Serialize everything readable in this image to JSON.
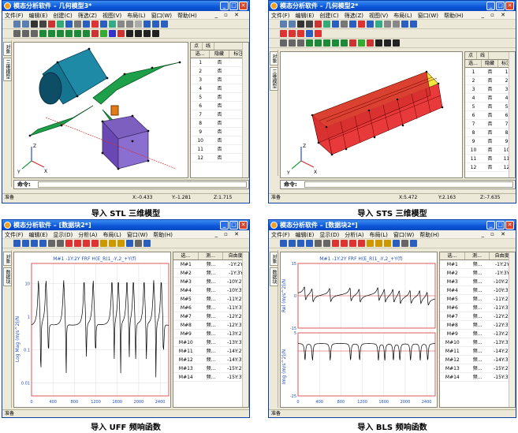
{
  "panels": [
    {
      "window_title": "模态分析软件 – 几何模型3*",
      "menus": [
        "文件(F)",
        "编辑(E)",
        "创建(C)",
        "筛选(Z)",
        "视图(V)",
        "布局(L)",
        "窗口(W)",
        "帮助(H)"
      ],
      "side_tabs": [
        "对象",
        "三维模型"
      ],
      "table_tabs": [
        "点",
        "线"
      ],
      "table_headers": [
        "选...",
        "隐藏",
        "标注"
      ],
      "table_rows": [
        [
          "1",
          "否",
          ""
        ],
        [
          "2",
          "否",
          ""
        ],
        [
          "3",
          "否",
          ""
        ],
        [
          "4",
          "否",
          ""
        ],
        [
          "5",
          "否",
          ""
        ],
        [
          "6",
          "否",
          ""
        ],
        [
          "7",
          "否",
          ""
        ],
        [
          "8",
          "否",
          ""
        ],
        [
          "9",
          "否",
          ""
        ],
        [
          "10",
          "否",
          ""
        ],
        [
          "11",
          "否",
          ""
        ],
        [
          "12",
          "否",
          ""
        ]
      ],
      "command_label": "命令:",
      "status_ready": "准备",
      "status_x": "X:-0.433",
      "status_y": "Y:-1.281",
      "status_z": "Z:1.715",
      "caption": "导入 STL 三维模型",
      "axis_labels": [
        "X",
        "Y",
        "Z"
      ]
    },
    {
      "window_title": "模态分析软件 – 几何模型2*",
      "menus": [
        "文件(F)",
        "编辑(E)",
        "创建(C)",
        "筛选(Z)",
        "视图(V)",
        "布局(L)",
        "窗口(W)",
        "帮助(H)"
      ],
      "side_tabs": [
        "对象",
        "三维模型"
      ],
      "table_tabs": [
        "点",
        "线"
      ],
      "table_headers": [
        "选...",
        "隐藏",
        "标注"
      ],
      "table_rows": [
        [
          "1",
          "否",
          "1"
        ],
        [
          "2",
          "否",
          "2"
        ],
        [
          "3",
          "否",
          "3"
        ],
        [
          "4",
          "否",
          "4"
        ],
        [
          "5",
          "否",
          "5"
        ],
        [
          "6",
          "否",
          "6"
        ],
        [
          "7",
          "否",
          "7"
        ],
        [
          "8",
          "否",
          "8"
        ],
        [
          "9",
          "否",
          "9"
        ],
        [
          "10",
          "否",
          "10"
        ],
        [
          "11",
          "否",
          "11"
        ],
        [
          "12",
          "否",
          "12"
        ]
      ],
      "command_label": "命令:",
      "status_ready": "准备",
      "status_x": "X:5.472",
      "status_y": "Y:2.163",
      "status_z": "Z:-7.635",
      "caption": "导入 STS 三维模型",
      "axis_labels": [
        "X",
        "Y",
        "Z"
      ]
    },
    {
      "window_title": "模态分析软件 – [数据块2*]",
      "menus": [
        "文件(F)",
        "编辑(E)",
        "显示(D)",
        "分析(A)",
        "布局(L)",
        "窗口(W)",
        "帮助(H)"
      ],
      "side_tabs": [
        "对象",
        "数据块"
      ],
      "table_headers": [
        "选...",
        "测...",
        "自由度"
      ],
      "table_rows": [
        [
          "M#1",
          "频...",
          "-1Y:2Y"
        ],
        [
          "M#2",
          "频...",
          "-1Y:3Y"
        ],
        [
          "M#3",
          "频...",
          "-10Y:2Y"
        ],
        [
          "M#4",
          "频...",
          "-10Y:3Y"
        ],
        [
          "M#5",
          "频...",
          "-11Y:2Y"
        ],
        [
          "M#6",
          "频...",
          "-11Y:3Y"
        ],
        [
          "M#7",
          "频...",
          "-12Y:2Y"
        ],
        [
          "M#8",
          "频...",
          "-12Y:3Y"
        ],
        [
          "M#9",
          "频...",
          "-13Y:2Y"
        ],
        [
          "M#10",
          "频...",
          "-13Y:3Y"
        ],
        [
          "M#11",
          "频...",
          "-14Y:2Y"
        ],
        [
          "M#12",
          "频...",
          "-14Y:3Y"
        ],
        [
          "M#13",
          "频...",
          "-15Y:2Y"
        ],
        [
          "M#14",
          "频...",
          "-15Y:3Y"
        ]
      ],
      "status_ready": "准备",
      "caption": "导入 UFF 频响函数",
      "plot_title": "M#1 -1Y:2Y FRF H(E_R)1_-Y,2_+Y(f)"
    },
    {
      "window_title": "模态分析软件 – [数据块2*]",
      "menus": [
        "文件(F)",
        "编辑(E)",
        "显示(D)",
        "分析(A)",
        "布局(L)",
        "窗口(W)",
        "帮助(H)"
      ],
      "side_tabs": [
        "对象",
        "数据块"
      ],
      "table_headers": [
        "选...",
        "测...",
        "自由度"
      ],
      "table_rows": [
        [
          "M#1",
          "频...",
          "-1Y:2Y"
        ],
        [
          "M#2",
          "频...",
          "-1Y:3Y"
        ],
        [
          "M#3",
          "频...",
          "-10Y:2Y"
        ],
        [
          "M#4",
          "频...",
          "-10Y:3Y"
        ],
        [
          "M#5",
          "频...",
          "-11Y:2Y"
        ],
        [
          "M#6",
          "频...",
          "-11Y:3Y"
        ],
        [
          "M#7",
          "频...",
          "-12Y:2Y"
        ],
        [
          "M#8",
          "频...",
          "-12Y:3Y"
        ],
        [
          "M#9",
          "频...",
          "-13Y:2Y"
        ],
        [
          "M#10",
          "频...",
          "-13Y:3Y"
        ],
        [
          "M#11",
          "频...",
          "-14Y:2Y"
        ],
        [
          "M#12",
          "频...",
          "-14Y:3Y"
        ],
        [
          "M#13",
          "频...",
          "-15Y:2Y"
        ],
        [
          "M#14",
          "频...",
          "-15Y:3Y"
        ]
      ],
      "status_ready": "准备",
      "caption": "导入 BLS 频响函数",
      "plot_title": "M#1 -1Y:2Y FRF H(E_R)1_-Y,2_+Y(f)"
    }
  ],
  "chart_data": [
    {
      "type": "line",
      "title": "M#1 -1Y:2Y FRF H(E_R)1_-Y,2_+Y(f)",
      "xlabel": "",
      "ylabel": "Log Mag (m/s^2)/N",
      "y_scale": "log",
      "xlim": [
        0,
        2560
      ],
      "x_ticks": [
        0,
        400,
        800,
        1200,
        1600,
        2000,
        2400
      ],
      "y_ticks": [
        10,
        1,
        0.1,
        0.01
      ],
      "grid": true,
      "peaks_x": [
        130,
        270,
        600,
        980,
        1150,
        1500,
        1620,
        1780,
        1900,
        2100,
        2280,
        2420
      ]
    },
    {
      "type": "line",
      "title": "M#1 -1Y:2Y FRF H(E_R)1_-Y,2_+Y(f)",
      "subplots": [
        {
          "ylabel": "Rel (m/s^2)/N",
          "ylim": [
            -15,
            15
          ],
          "y_ticks": [
            15,
            0,
            -15
          ]
        },
        {
          "ylabel": "Img (m/s^2)/N",
          "ylim": [
            -25,
            5
          ],
          "y_ticks": [
            5,
            -25
          ]
        }
      ],
      "xlim": [
        0,
        2560
      ],
      "x_ticks": [
        0,
        400,
        800,
        1200,
        1600,
        2000,
        2400
      ],
      "grid": true,
      "peaks_x": [
        130,
        270,
        600,
        980,
        1150,
        1500,
        1620,
        1780,
        1900,
        2100,
        2280,
        2420
      ]
    }
  ]
}
